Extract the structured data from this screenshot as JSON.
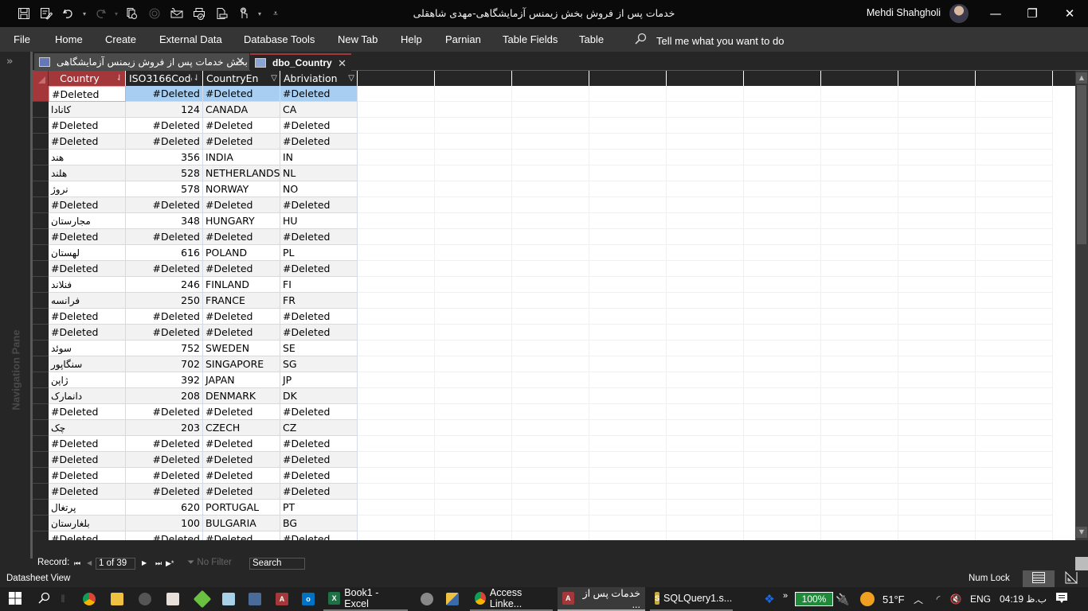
{
  "window": {
    "title": "خدمات پس از فروش بخش زیمنس آزمایشگاهی-مهدی شاهقلی",
    "user_name": "Mehdi Shahgholi",
    "controls": {
      "minimize": "—",
      "restore": "❐",
      "close": "✕"
    }
  },
  "quick_access": [
    {
      "name": "save-icon",
      "glyph": "💾"
    },
    {
      "name": "edit-form-icon",
      "glyph": "✎"
    },
    {
      "name": "undo-icon",
      "glyph": "↶"
    },
    {
      "name": "redo-icon",
      "glyph": "↷"
    },
    {
      "name": "refresh-icon",
      "glyph": "⟳"
    },
    {
      "name": "sync-icon",
      "glyph": "⊘"
    },
    {
      "name": "email-icon",
      "glyph": "✉"
    },
    {
      "name": "print-check-icon",
      "glyph": "⎙"
    },
    {
      "name": "print-preview-icon",
      "glyph": "🖶"
    },
    {
      "name": "touch-mode-icon",
      "glyph": "☝"
    },
    {
      "name": "customize-icon",
      "glyph": "⩡"
    }
  ],
  "menu": {
    "items": [
      "File",
      "Home",
      "Create",
      "External Data",
      "Database Tools",
      "New Tab",
      "Help",
      "Parnian",
      "Table Fields",
      "Table"
    ],
    "tell_me": "Tell me what you want to do"
  },
  "nav_pane": {
    "label": "Navigation Pane",
    "expand_glyph": "»"
  },
  "tabs": [
    {
      "label": "بخش خدمات پس از فروش زیمنس آزمایشگاهی",
      "active": false,
      "close": "✕"
    },
    {
      "label": "dbo_Country",
      "active": true,
      "close": "✕"
    }
  ],
  "table": {
    "columns": [
      {
        "label": "Country",
        "sort": "⇃",
        "selected": true
      },
      {
        "label": "ISO3166Code",
        "sort": "⇃",
        "selected": false
      },
      {
        "label": "CountryEn",
        "sort": "▽",
        "selected": false
      },
      {
        "label": "Abriviation",
        "sort": "▽",
        "selected": false
      }
    ],
    "rows": [
      [
        "#Deleted",
        "#Deleted",
        "#Deleted",
        "#Deleted"
      ],
      [
        "کانادا",
        "124",
        "CANADA",
        "CA"
      ],
      [
        "#Deleted",
        "#Deleted",
        "#Deleted",
        "#Deleted"
      ],
      [
        "#Deleted",
        "#Deleted",
        "#Deleted",
        "#Deleted"
      ],
      [
        "هند",
        "356",
        "INDIA",
        "IN"
      ],
      [
        "هلند",
        "528",
        "NETHERLANDS",
        "NL"
      ],
      [
        "نروژ",
        "578",
        "NORWAY",
        "NO"
      ],
      [
        "#Deleted",
        "#Deleted",
        "#Deleted",
        "#Deleted"
      ],
      [
        "مجارستان",
        "348",
        "HUNGARY",
        "HU"
      ],
      [
        "#Deleted",
        "#Deleted",
        "#Deleted",
        "#Deleted"
      ],
      [
        "لهستان",
        "616",
        "POLAND",
        "PL"
      ],
      [
        "#Deleted",
        "#Deleted",
        "#Deleted",
        "#Deleted"
      ],
      [
        "فنلاند",
        "246",
        "FINLAND",
        "FI"
      ],
      [
        "فرانسه",
        "250",
        "FRANCE",
        "FR"
      ],
      [
        "#Deleted",
        "#Deleted",
        "#Deleted",
        "#Deleted"
      ],
      [
        "#Deleted",
        "#Deleted",
        "#Deleted",
        "#Deleted"
      ],
      [
        "سوئد",
        "752",
        "SWEDEN",
        "SE"
      ],
      [
        "سنگاپور",
        "702",
        "SINGAPORE",
        "SG"
      ],
      [
        "ژاپن",
        "392",
        "JAPAN",
        "JP"
      ],
      [
        "دانمارک",
        "208",
        "DENMARK",
        "DK"
      ],
      [
        "#Deleted",
        "#Deleted",
        "#Deleted",
        "#Deleted"
      ],
      [
        "چک",
        "203",
        "CZECH",
        "CZ"
      ],
      [
        "#Deleted",
        "#Deleted",
        "#Deleted",
        "#Deleted"
      ],
      [
        "#Deleted",
        "#Deleted",
        "#Deleted",
        "#Deleted"
      ],
      [
        "#Deleted",
        "#Deleted",
        "#Deleted",
        "#Deleted"
      ],
      [
        "#Deleted",
        "#Deleted",
        "#Deleted",
        "#Deleted"
      ],
      [
        "پرتغال",
        "620",
        "PORTUGAL",
        "PT"
      ],
      [
        "بلغارستان",
        "100",
        "BULGARIA",
        "BG"
      ],
      [
        "#Deleted",
        "#Deleted",
        "#Deleted",
        "#Deleted"
      ],
      [
        "#Deleted",
        "#Deleted",
        "#Deleted",
        "#Deleted"
      ]
    ],
    "current_row": 0
  },
  "record_nav": {
    "label": "Record:",
    "first": "⏮",
    "prev": "◀",
    "position": "1 of 39",
    "next": "▶",
    "last": "⏭",
    "new": "▶*",
    "filter": "No Filter",
    "search": "Search"
  },
  "status": {
    "view": "Datasheet View",
    "num_lock": "Num Lock"
  },
  "taskbar": {
    "apps": [
      {
        "label": "Book1 - Excel",
        "icon": "X",
        "color": "#1e7145"
      },
      {
        "label": "Access Linke...",
        "icon": "●",
        "color": "#db4437"
      },
      {
        "label": "خدمات پس از ...",
        "icon": "A",
        "color": "#a4373a"
      },
      {
        "label": "SQLQuery1.s...",
        "icon": "S",
        "color": "#c8a93a"
      }
    ],
    "battery": "100%",
    "weather": "51°F",
    "language": "ENG",
    "time": "04:19 ب.ظ"
  }
}
